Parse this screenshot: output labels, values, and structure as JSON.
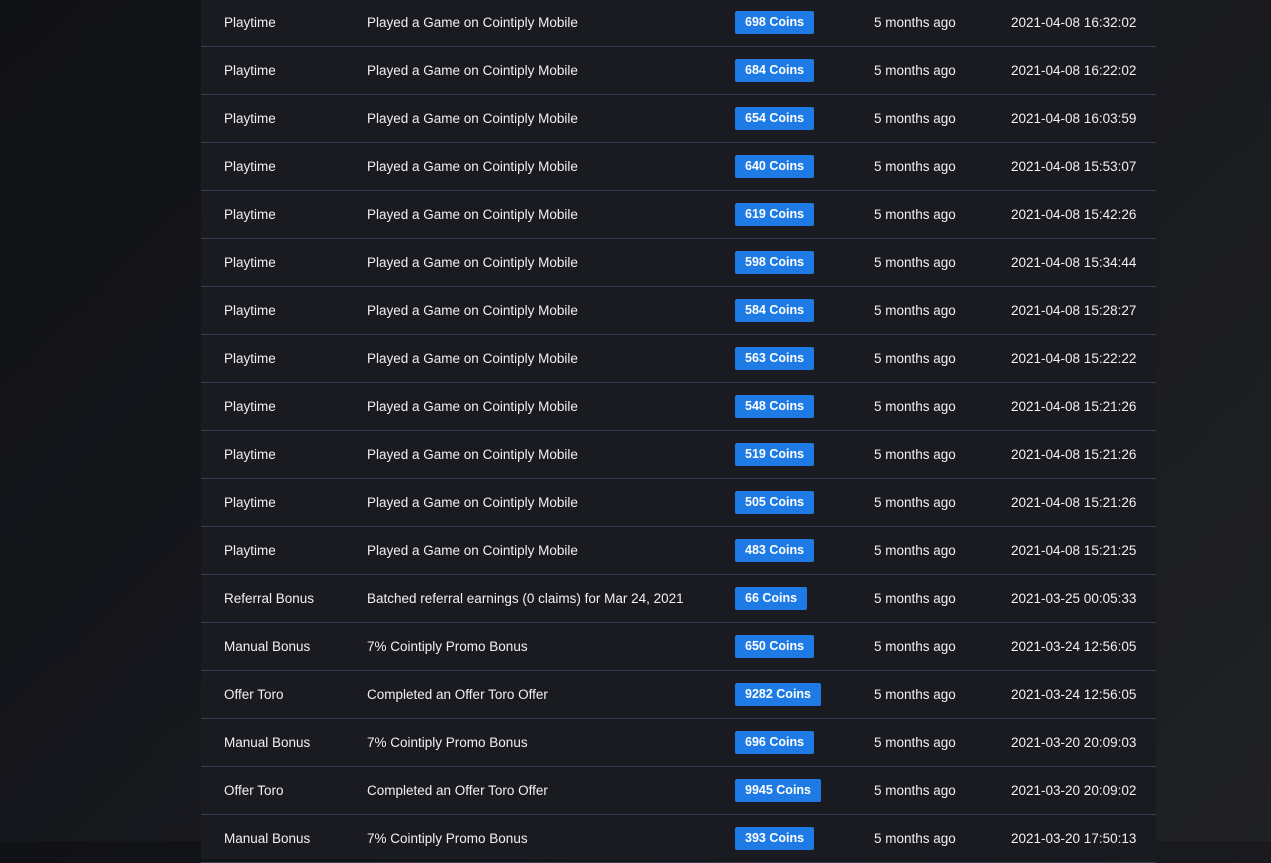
{
  "colors": {
    "badge": "#1e7be6",
    "row_divider": "#3a3c52",
    "panel": "#1a1b20"
  },
  "transactions": [
    {
      "type": "Playtime",
      "description": "Played a Game on Cointiply Mobile",
      "amount": "698 Coins",
      "ago": "5 months ago",
      "date": "2021-04-08 16:32:02"
    },
    {
      "type": "Playtime",
      "description": "Played a Game on Cointiply Mobile",
      "amount": "684 Coins",
      "ago": "5 months ago",
      "date": "2021-04-08 16:22:02"
    },
    {
      "type": "Playtime",
      "description": "Played a Game on Cointiply Mobile",
      "amount": "654 Coins",
      "ago": "5 months ago",
      "date": "2021-04-08 16:03:59"
    },
    {
      "type": "Playtime",
      "description": "Played a Game on Cointiply Mobile",
      "amount": "640 Coins",
      "ago": "5 months ago",
      "date": "2021-04-08 15:53:07"
    },
    {
      "type": "Playtime",
      "description": "Played a Game on Cointiply Mobile",
      "amount": "619 Coins",
      "ago": "5 months ago",
      "date": "2021-04-08 15:42:26"
    },
    {
      "type": "Playtime",
      "description": "Played a Game on Cointiply Mobile",
      "amount": "598 Coins",
      "ago": "5 months ago",
      "date": "2021-04-08 15:34:44"
    },
    {
      "type": "Playtime",
      "description": "Played a Game on Cointiply Mobile",
      "amount": "584 Coins",
      "ago": "5 months ago",
      "date": "2021-04-08 15:28:27"
    },
    {
      "type": "Playtime",
      "description": "Played a Game on Cointiply Mobile",
      "amount": "563 Coins",
      "ago": "5 months ago",
      "date": "2021-04-08 15:22:22"
    },
    {
      "type": "Playtime",
      "description": "Played a Game on Cointiply Mobile",
      "amount": "548 Coins",
      "ago": "5 months ago",
      "date": "2021-04-08 15:21:26"
    },
    {
      "type": "Playtime",
      "description": "Played a Game on Cointiply Mobile",
      "amount": "519 Coins",
      "ago": "5 months ago",
      "date": "2021-04-08 15:21:26"
    },
    {
      "type": "Playtime",
      "description": "Played a Game on Cointiply Mobile",
      "amount": "505 Coins",
      "ago": "5 months ago",
      "date": "2021-04-08 15:21:26"
    },
    {
      "type": "Playtime",
      "description": "Played a Game on Cointiply Mobile",
      "amount": "483 Coins",
      "ago": "5 months ago",
      "date": "2021-04-08 15:21:25"
    },
    {
      "type": "Referral Bonus",
      "description": "Batched referral earnings (0 claims) for Mar 24, 2021",
      "amount": "66 Coins",
      "ago": "5 months ago",
      "date": "2021-03-25 00:05:33"
    },
    {
      "type": "Manual Bonus",
      "description": "7% Cointiply Promo Bonus",
      "amount": "650 Coins",
      "ago": "5 months ago",
      "date": "2021-03-24 12:56:05"
    },
    {
      "type": "Offer Toro",
      "description": "Completed an Offer Toro Offer",
      "amount": "9282 Coins",
      "ago": "5 months ago",
      "date": "2021-03-24 12:56:05"
    },
    {
      "type": "Manual Bonus",
      "description": "7% Cointiply Promo Bonus",
      "amount": "696 Coins",
      "ago": "5 months ago",
      "date": "2021-03-20 20:09:03"
    },
    {
      "type": "Offer Toro",
      "description": "Completed an Offer Toro Offer",
      "amount": "9945 Coins",
      "ago": "5 months ago",
      "date": "2021-03-20 20:09:02"
    },
    {
      "type": "Manual Bonus",
      "description": "7% Cointiply Promo Bonus",
      "amount": "393 Coins",
      "ago": "5 months ago",
      "date": "2021-03-20 17:50:13"
    }
  ]
}
